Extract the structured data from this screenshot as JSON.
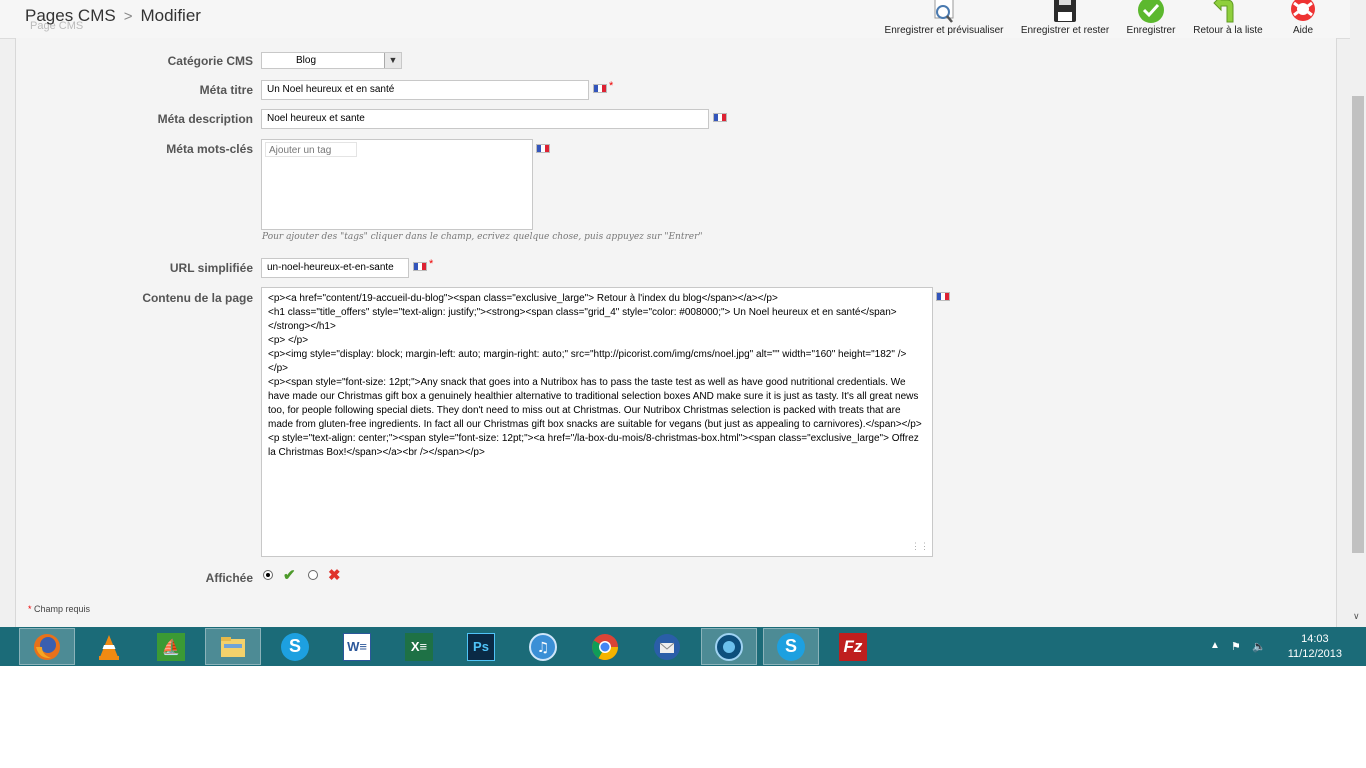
{
  "header": {
    "breadcrumb_root": "Pages CMS",
    "breadcrumb_separator": ">",
    "breadcrumb_current": "Modifier",
    "ghost_label": "Page CMS"
  },
  "toolbar": {
    "buttons": [
      {
        "label": "Enregistrer et prévisualiser",
        "icon": "magnifier-icon"
      },
      {
        "label": "Enregistrer et rester",
        "icon": "floppy-disk-icon"
      },
      {
        "label": "Enregistrer",
        "icon": "green-check-icon"
      },
      {
        "label": "Retour à la liste",
        "icon": "back-arrow-icon"
      },
      {
        "label": "Aide",
        "icon": "lifebuoy-icon"
      }
    ]
  },
  "form": {
    "category": {
      "label": "Catégorie CMS",
      "value": "Blog"
    },
    "meta_title": {
      "label": "Méta titre",
      "value": "Un Noel heureux et en santé",
      "required": "*"
    },
    "meta_description": {
      "label": "Méta description",
      "value": "Noel heureux et sante"
    },
    "meta_keywords": {
      "label": "Méta mots-clés",
      "placeholder": "Ajouter un tag",
      "help": "Pour ajouter des \"tags\" cliquer dans le champ, ecrivez quelque chose, puis appuyez sur \"Entrer\""
    },
    "friendly_url": {
      "label": "URL simplifiée",
      "value": "un-noel-heureux-et-en-sante",
      "required": "*"
    },
    "content": {
      "label": "Contenu de la page",
      "lines": [
        "<p><a href=\"content/19-accueil-du-blog\"><span class=\"exclusive_large\"> Retour à l'index du blog</span></a></p>",
        "<h1 class=\"title_offers\" style=\"text-align: justify;\"><strong><span class=\"grid_4\" style=\"color: #008000;\">                    Un Noel heureux et en santé</span></strong></h1>",
        "<p> </p>",
        "<p><img style=\"display: block; margin-left: auto; margin-right: auto;\" src=\"http://picorist.com/img/cms/noel.jpg\" alt=\"\" width=\"160\" height=\"182\" /></p>",
        "<p><span style=\"font-size: 12pt;\">Any snack that goes into a Nutribox has to pass the taste test as well as have good nutritional credentials.  We have made our Christmas gift box a genuinely healthier alternative to traditional selection boxes AND make sure it is just as tasty. It's all great news too, for people following special diets. They don't need to miss out at Christmas. Our Nutribox Christmas selection is packed with treats that are made from gluten-free ingredients. In fact all our Christmas gift box snacks are suitable for vegans (but just as appealing to carnivores).</span></p>",
        "<p style=\"text-align: center;\"><span style=\"font-size: 12pt;\"><a href=\"/la-box-du-mois/8-christmas-box.html\"><span class=\"exclusive_large\">  Offrez la Christmas Box!</span></a><br /></span></p>"
      ]
    },
    "active": {
      "label": "Affichée",
      "selected": "yes"
    },
    "required_note_star": "*",
    "required_note": " Champ requis"
  },
  "taskbar": {
    "apps": [
      {
        "name": "firefox-icon",
        "active": true
      },
      {
        "name": "vlc-icon",
        "active": false
      },
      {
        "name": "sailing-app-icon",
        "active": false
      },
      {
        "name": "file-explorer-icon",
        "active": true
      },
      {
        "name": "skype-icon",
        "active": false
      },
      {
        "name": "word-icon",
        "active": false
      },
      {
        "name": "excel-icon",
        "active": false
      },
      {
        "name": "photoshop-icon",
        "active": false
      },
      {
        "name": "itunes-icon",
        "active": false
      },
      {
        "name": "chrome-icon",
        "active": false
      },
      {
        "name": "thunderbird-icon",
        "active": false
      },
      {
        "name": "globe-app-icon",
        "active": true
      },
      {
        "name": "skype-icon-2",
        "active": true
      },
      {
        "name": "filezilla-icon",
        "active": false
      }
    ],
    "clock": {
      "time": "14:03",
      "date": "11/12/2013"
    }
  },
  "colors": {
    "taskbar": "#1b6b78",
    "flag_blue": "#3355bb",
    "flag_white": "#ffffff",
    "flag_red": "#dd2233",
    "check_green": "#4c9a2a",
    "cross_red": "#e0332b"
  }
}
